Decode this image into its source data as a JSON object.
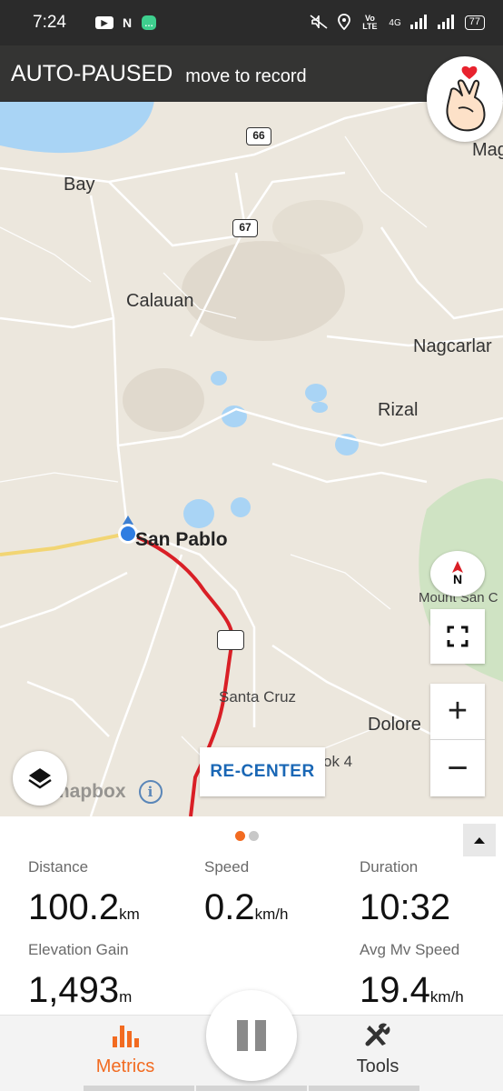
{
  "status_bar": {
    "time": "7:24",
    "battery": "77",
    "icons": [
      "youtube-icon",
      "n-app-icon",
      "chat-icon",
      "mute-icon",
      "location-icon",
      "volte-icon",
      "signal-icon",
      "signal-icon",
      "battery-icon"
    ],
    "volte": "Vo LTE",
    "network": "4G",
    "n_app": "N"
  },
  "banner": {
    "title": "AUTO-PAUSED",
    "subtitle": "move to record"
  },
  "map": {
    "labels": {
      "bay": "Bay",
      "calauan": "Calauan",
      "nagcarlan": "Nagcarlar",
      "rizal": "Rizal",
      "san_pablo": "San Pablo",
      "santa_cruz": "Santa Cruz",
      "dolores": "Dolore",
      "mount_san": "Mount San C",
      "mag": "Mag",
      "brgy": "ok 4"
    },
    "shields": {
      "r66": "66",
      "r67": "67",
      "blank": ""
    },
    "compass_label": "N",
    "recenter_label": "RE-CENTER",
    "attribution": "mapbox",
    "info_label": "i",
    "zoom_in_label": "+",
    "zoom_out_label": "−"
  },
  "metrics": {
    "distance": {
      "label": "Distance",
      "value": "100.2",
      "unit": "km"
    },
    "speed": {
      "label": "Speed",
      "value": "0.2",
      "unit": "km/h"
    },
    "duration": {
      "label": "Duration",
      "value": "10:32",
      "unit": ""
    },
    "elevation": {
      "label": "Elevation Gain",
      "value": "1,493",
      "unit": "m"
    },
    "avg_speed": {
      "label": "Avg Mv Speed",
      "value": "19.4",
      "unit": "km/h"
    }
  },
  "pager": {
    "pages": 2,
    "active": 0
  },
  "nav": {
    "metrics_label": "Metrics",
    "tools_label": "Tools"
  },
  "colors": {
    "accent": "#f26b21",
    "route": "#d91f26",
    "recenter": "#1a67b5",
    "water": "#a9d4f5",
    "map_bg": "#ece7dd"
  }
}
